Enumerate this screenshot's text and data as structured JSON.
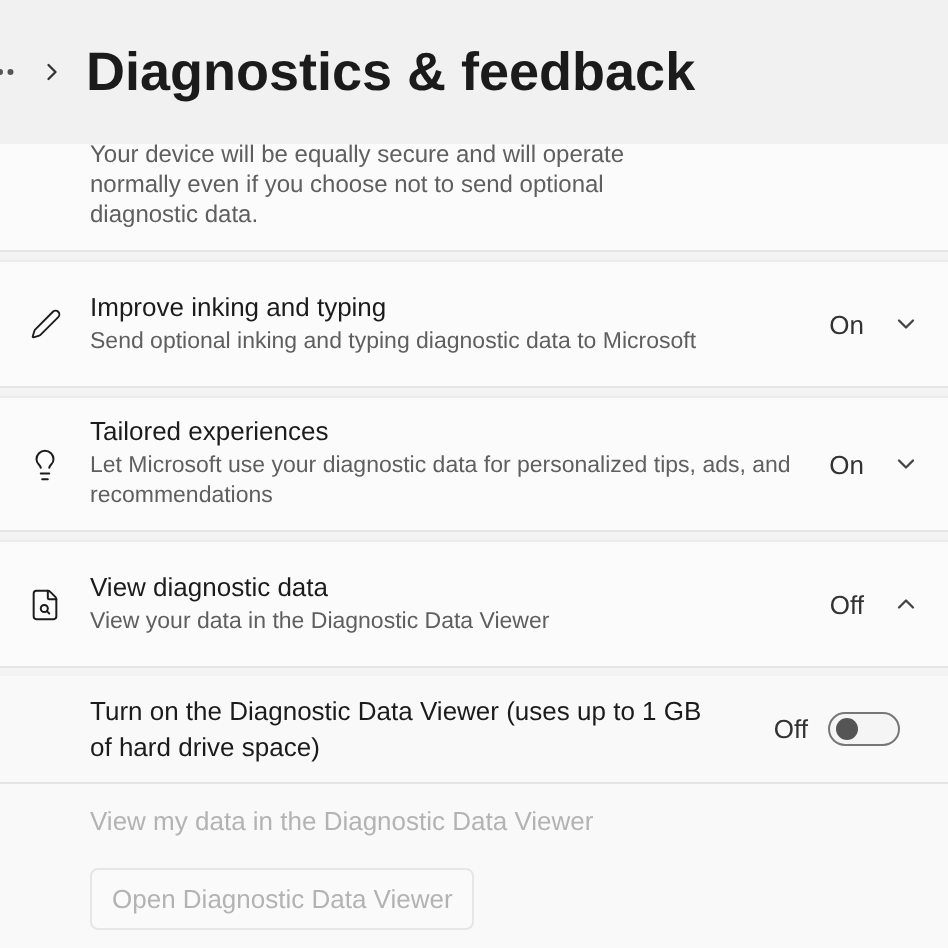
{
  "header": {
    "title": "Diagnostics & feedback"
  },
  "intro": {
    "text": "Your device will be equally secure and will operate normally even if you choose not to send optional diagnostic data."
  },
  "settings": [
    {
      "kind": "pen",
      "title": "Improve inking and typing",
      "description": "Send optional inking and typing diagnostic data to Microsoft",
      "value": "On",
      "expanded": false
    },
    {
      "kind": "bulb",
      "title": "Tailored experiences",
      "description": "Let Microsoft use your diagnostic data for personalized tips, ads, and recommendations",
      "value": "On",
      "expanded": false
    },
    {
      "kind": "viewer",
      "title": "View diagnostic data",
      "description": "View your data in the Diagnostic Data Viewer",
      "value": "Off",
      "expanded": true,
      "toggle": {
        "label": "Turn on the Diagnostic Data Viewer (uses up to 1 GB of hard drive space)",
        "value": "Off",
        "on": false
      },
      "link": {
        "label": "View my data in the Diagnostic Data Viewer",
        "disabled": true
      },
      "button": {
        "label": "Open Diagnostic Data Viewer",
        "disabled": true
      }
    }
  ]
}
